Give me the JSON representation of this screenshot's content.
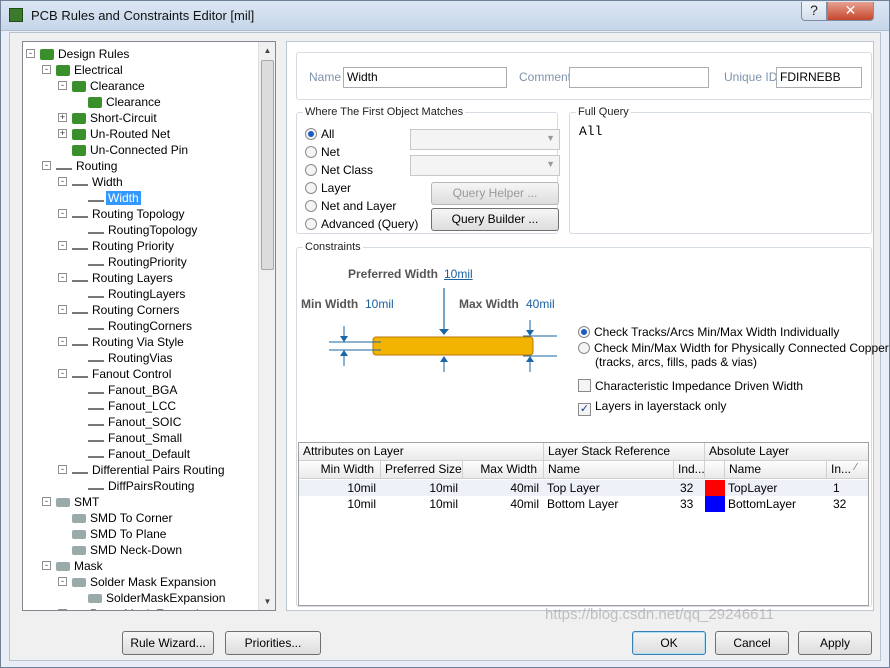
{
  "window": {
    "title": "PCB Rules and Constraints Editor [mil]",
    "help": "?",
    "close": "✕"
  },
  "tree": [
    {
      "depth": 0,
      "label": "Design Rules",
      "exp": "-",
      "icon": "rule"
    },
    {
      "depth": 1,
      "label": "Electrical",
      "exp": "-",
      "icon": "rule"
    },
    {
      "depth": 2,
      "label": "Clearance",
      "exp": "-",
      "icon": "rule"
    },
    {
      "depth": 3,
      "label": "Clearance",
      "exp": "",
      "icon": "rule"
    },
    {
      "depth": 2,
      "label": "Short-Circuit",
      "exp": "+",
      "icon": "rule"
    },
    {
      "depth": 2,
      "label": "Un-Routed Net",
      "exp": "+",
      "icon": "rule"
    },
    {
      "depth": 2,
      "label": "Un-Connected Pin",
      "exp": "",
      "icon": "rule"
    },
    {
      "depth": 1,
      "label": "Routing",
      "exp": "-",
      "icon": "wire"
    },
    {
      "depth": 2,
      "label": "Width",
      "exp": "-",
      "icon": "wire"
    },
    {
      "depth": 3,
      "label": "Width",
      "exp": "",
      "icon": "wire",
      "selected": true
    },
    {
      "depth": 2,
      "label": "Routing Topology",
      "exp": "-",
      "icon": "wire"
    },
    {
      "depth": 3,
      "label": "RoutingTopology",
      "exp": "",
      "icon": "wire"
    },
    {
      "depth": 2,
      "label": "Routing Priority",
      "exp": "-",
      "icon": "wire"
    },
    {
      "depth": 3,
      "label": "RoutingPriority",
      "exp": "",
      "icon": "wire"
    },
    {
      "depth": 2,
      "label": "Routing Layers",
      "exp": "-",
      "icon": "wire"
    },
    {
      "depth": 3,
      "label": "RoutingLayers",
      "exp": "",
      "icon": "wire"
    },
    {
      "depth": 2,
      "label": "Routing Corners",
      "exp": "-",
      "icon": "wire"
    },
    {
      "depth": 3,
      "label": "RoutingCorners",
      "exp": "",
      "icon": "wire"
    },
    {
      "depth": 2,
      "label": "Routing Via Style",
      "exp": "-",
      "icon": "wire"
    },
    {
      "depth": 3,
      "label": "RoutingVias",
      "exp": "",
      "icon": "wire"
    },
    {
      "depth": 2,
      "label": "Fanout Control",
      "exp": "-",
      "icon": "wire"
    },
    {
      "depth": 3,
      "label": "Fanout_BGA",
      "exp": "",
      "icon": "wire"
    },
    {
      "depth": 3,
      "label": "Fanout_LCC",
      "exp": "",
      "icon": "wire"
    },
    {
      "depth": 3,
      "label": "Fanout_SOIC",
      "exp": "",
      "icon": "wire"
    },
    {
      "depth": 3,
      "label": "Fanout_Small",
      "exp": "",
      "icon": "wire"
    },
    {
      "depth": 3,
      "label": "Fanout_Default",
      "exp": "",
      "icon": "wire"
    },
    {
      "depth": 2,
      "label": "Differential Pairs Routing",
      "exp": "-",
      "icon": "wire"
    },
    {
      "depth": 3,
      "label": "DiffPairsRouting",
      "exp": "",
      "icon": "wire"
    },
    {
      "depth": 1,
      "label": "SMT",
      "exp": "-",
      "icon": "chip"
    },
    {
      "depth": 2,
      "label": "SMD To Corner",
      "exp": "",
      "icon": "chip"
    },
    {
      "depth": 2,
      "label": "SMD To Plane",
      "exp": "",
      "icon": "chip"
    },
    {
      "depth": 2,
      "label": "SMD Neck-Down",
      "exp": "",
      "icon": "chip"
    },
    {
      "depth": 1,
      "label": "Mask",
      "exp": "-",
      "icon": "chip"
    },
    {
      "depth": 2,
      "label": "Solder Mask Expansion",
      "exp": "-",
      "icon": "chip"
    },
    {
      "depth": 3,
      "label": "SolderMaskExpansion",
      "exp": "",
      "icon": "chip"
    },
    {
      "depth": 2,
      "label": "Paste Mask Expansion",
      "exp": "-",
      "icon": "chip"
    }
  ],
  "header": {
    "name_label": "Name",
    "name_value": "Width",
    "comment_label": "Comment",
    "comment_value": "",
    "uid_label": "Unique ID",
    "uid_value": "FDIRNEBB"
  },
  "match": {
    "title": "Where The First Object Matches",
    "options": [
      "All",
      "Net",
      "Net Class",
      "Layer",
      "Net and Layer",
      "Advanced (Query)"
    ],
    "selected": "All",
    "query_helper": "Query Helper ...",
    "query_builder": "Query Builder ..."
  },
  "full_query": {
    "title": "Full Query",
    "text": "All"
  },
  "constraints": {
    "title": "Constraints",
    "preferred_label": "Preferred Width",
    "preferred_value": "10mil",
    "min_label": "Min Width",
    "min_value": "10mil",
    "max_label": "Max Width",
    "max_value": "40mil",
    "opt1": "Check Tracks/Arcs Min/Max Width Individually",
    "opt2a": "Check Min/Max Width for Physically Connected Copper",
    "opt2b": "(tracks, arcs, fills, pads & vias)",
    "opt_selected": 1,
    "chk1": "Characteristic Impedance Driven Width",
    "chk1_checked": false,
    "chk2": "Layers in layerstack only",
    "chk2_checked": true
  },
  "grid": {
    "group1": "Attributes on Layer",
    "group2": "Layer Stack Reference",
    "group3": "Absolute Layer",
    "cols": [
      "Min Width",
      "Preferred Size",
      "Max Width",
      "Name",
      "Ind...",
      "",
      "Name",
      "In..."
    ],
    "sort_mark": "⁄",
    "rows": [
      {
        "min": "10mil",
        "pref": "10mil",
        "max": "40mil",
        "name": "Top Layer",
        "ind": "32",
        "color": "#ff0000",
        "abs": "TopLayer",
        "in": "1"
      },
      {
        "min": "10mil",
        "pref": "10mil",
        "max": "40mil",
        "name": "Bottom Layer",
        "ind": "33",
        "color": "#0000ff",
        "abs": "BottomLayer",
        "in": "32"
      }
    ]
  },
  "buttons": {
    "rule_wizard": "Rule Wizard...",
    "priorities": "Priorities...",
    "ok": "OK",
    "cancel": "Cancel",
    "apply": "Apply"
  },
  "watermark": "https://blog.csdn.net/qq_29246611"
}
